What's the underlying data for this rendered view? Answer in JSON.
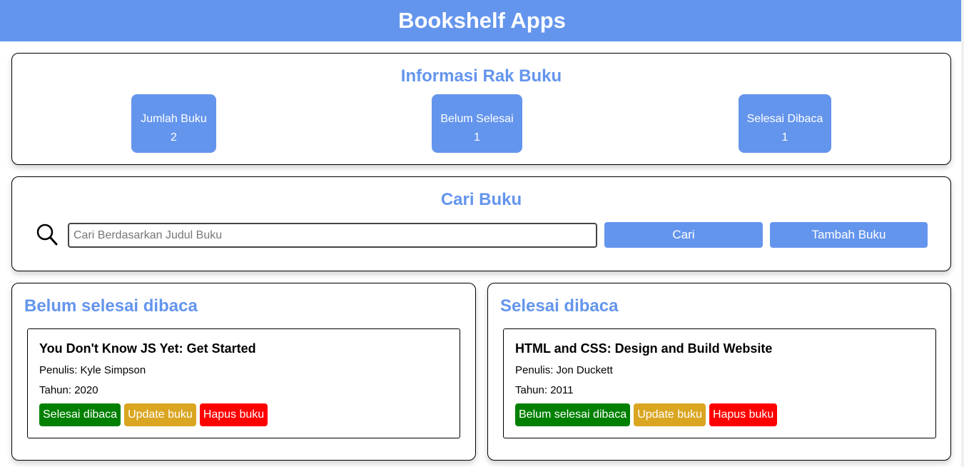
{
  "app": {
    "title": "Bookshelf Apps"
  },
  "info": {
    "heading": "Informasi Rak Buku",
    "stats": [
      {
        "label": "Jumlah Buku",
        "value": "2"
      },
      {
        "label": "Belum Selesai",
        "value": "1"
      },
      {
        "label": "Selesai Dibaca",
        "value": "1"
      }
    ]
  },
  "search": {
    "heading": "Cari Buku",
    "placeholder": "Cari Berdasarkan Judul Buku",
    "value": "",
    "search_button": "Cari",
    "add_button": "Tambah Buku",
    "icon": "search-icon"
  },
  "shelves": {
    "unfinished": {
      "heading": "Belum selesai dibaca",
      "books": [
        {
          "title": "You Don't Know JS Yet: Get Started",
          "author": "Penulis: Kyle Simpson",
          "year": "Tahun: 2020",
          "toggle_label": "Selesai dibaca",
          "update_label": "Update buku",
          "delete_label": "Hapus buku"
        }
      ]
    },
    "finished": {
      "heading": "Selesai dibaca",
      "books": [
        {
          "title": "HTML and CSS: Design and Build Website",
          "author": "Penulis: Jon Duckett",
          "year": "Tahun: 2011",
          "toggle_label": "Belum selesai dibaca",
          "update_label": "Update buku",
          "delete_label": "Hapus buku"
        }
      ]
    }
  },
  "colors": {
    "accent": "#6495ED",
    "done": "#008000",
    "update": "#DAA520",
    "delete": "#FF0000"
  }
}
